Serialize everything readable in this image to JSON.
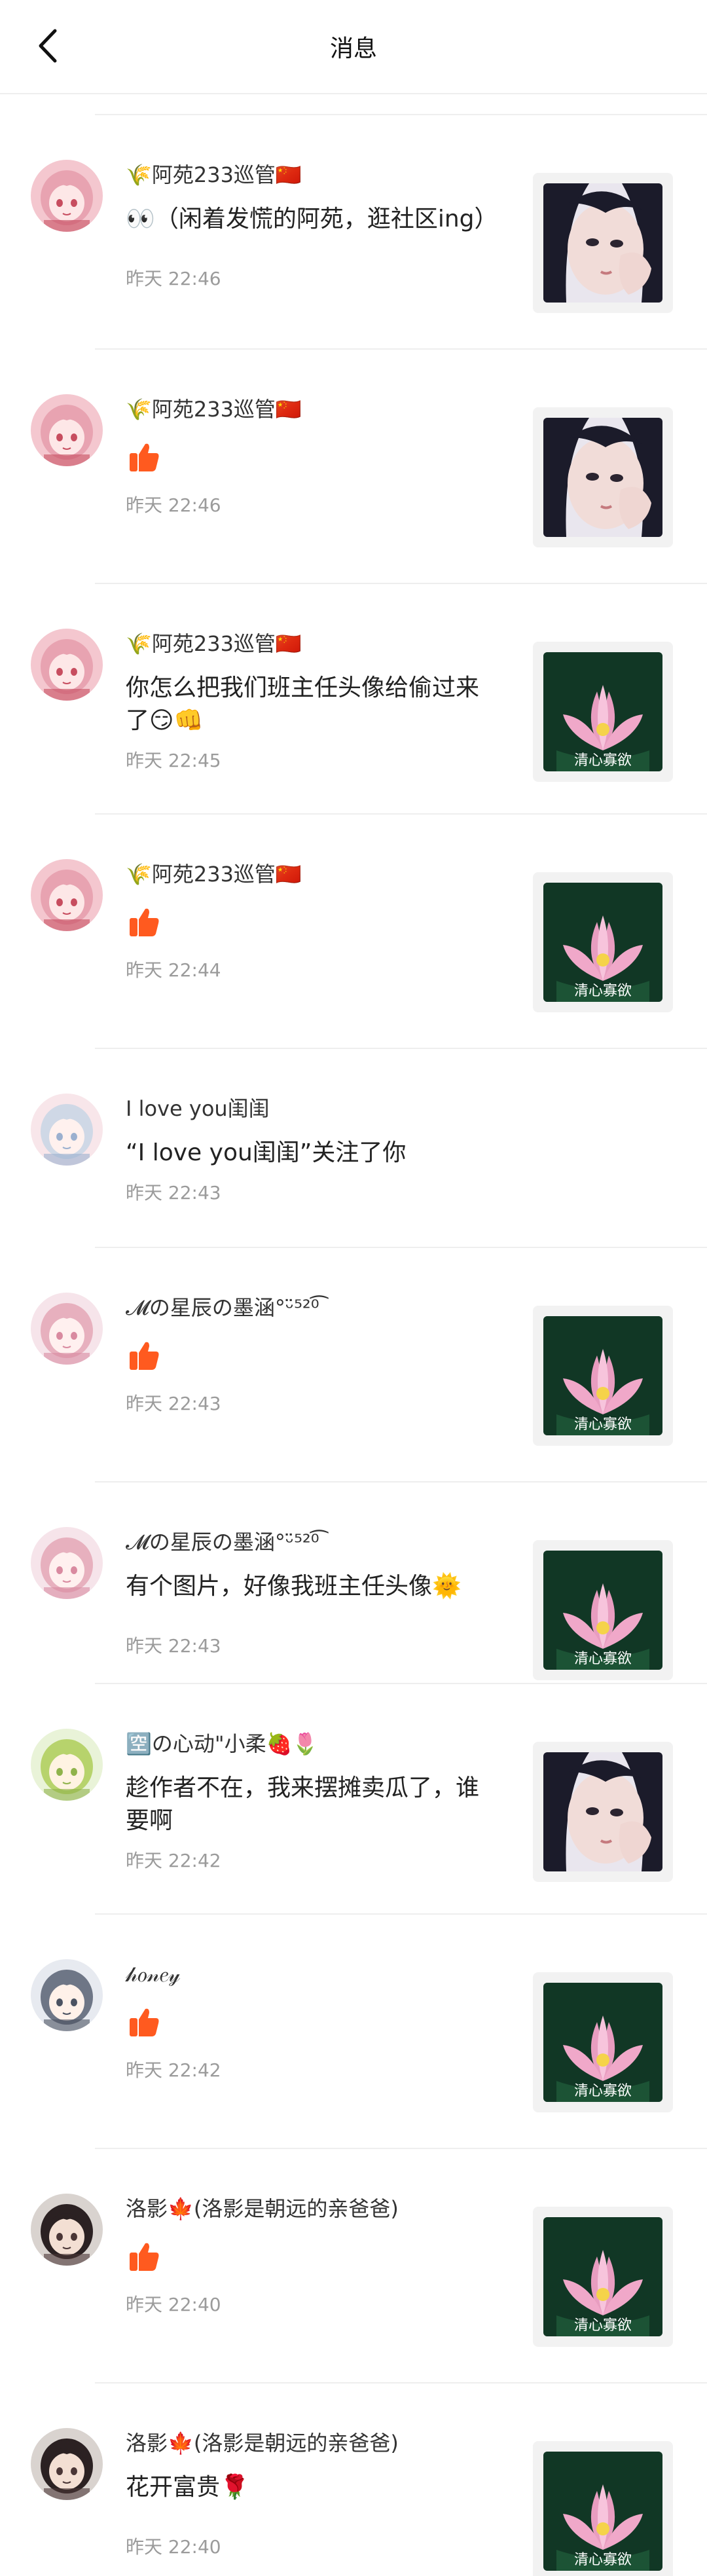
{
  "header": {
    "title": "消息"
  },
  "messages": [
    {
      "name": "🌾阿苑233巡管🇨🇳",
      "content": "👀（闲着发慌的阿苑，逛社区ing）",
      "time": "昨天 22:46",
      "thumb": "girl",
      "avatar": "pink"
    },
    {
      "name": "🌾阿苑233巡管🇨🇳",
      "content": "",
      "like": true,
      "time": "昨天 22:46",
      "thumb": "girl",
      "avatar": "pink"
    },
    {
      "name": "🌾阿苑233巡管🇨🇳",
      "content": "你怎么把我们班主任头像给偷过来了😏👊",
      "time": "昨天 22:45",
      "thumb": "lotus",
      "avatar": "pink"
    },
    {
      "name": "🌾阿苑233巡管🇨🇳",
      "content": "",
      "like": true,
      "time": "昨天 22:44",
      "thumb": "lotus",
      "avatar": "pink"
    },
    {
      "name": "I love you闺闺",
      "content": "“I love you闺闺”关注了你",
      "time": "昨天 22:43",
      "thumb": "",
      "avatar": "anime"
    },
    {
      "name": "𝓜の星辰の墨涵°ᵕ̈⁵²⁰͡",
      "content": "",
      "like": true,
      "time": "昨天 22:43",
      "thumb": "lotus",
      "avatar": "anime2"
    },
    {
      "name": "𝓜の星辰の墨涵°ᵕ̈⁵²⁰͡",
      "content": "有个图片，好像我班主任头像🌞",
      "time": "昨天 22:43",
      "thumb": "lotus",
      "avatar": "anime2"
    },
    {
      "name": "🈳の心动\"小柔🍓🌷",
      "content": "趁作者不在，我来摆摊卖瓜了，谁要啊",
      "time": "昨天 22:42",
      "thumb": "girl",
      "avatar": "green"
    },
    {
      "name": "𝒽𝑜𝓃𝑒𝓎",
      "content": "",
      "like": true,
      "time": "昨天 22:42",
      "thumb": "lotus",
      "avatar": "gray"
    },
    {
      "name": "洛影🍁(洛影是朝远的亲爸爸)",
      "content": "",
      "like": true,
      "time": "昨天 22:40",
      "thumb": "lotus",
      "avatar": "dark"
    },
    {
      "name": "洛影🍁(洛影是朝远的亲爸爸)",
      "content": "花开富贵🌹",
      "time": "昨天 22:40",
      "thumb": "lotus",
      "avatar": "dark"
    }
  ],
  "lotus_caption": "清心寡欲",
  "colors": {
    "like": "#ff5a1f",
    "divider": "#eeeeee",
    "time": "#9b9b9b"
  },
  "icons": {
    "back": "chevron-left-icon",
    "like": "thumbs-up-icon"
  }
}
